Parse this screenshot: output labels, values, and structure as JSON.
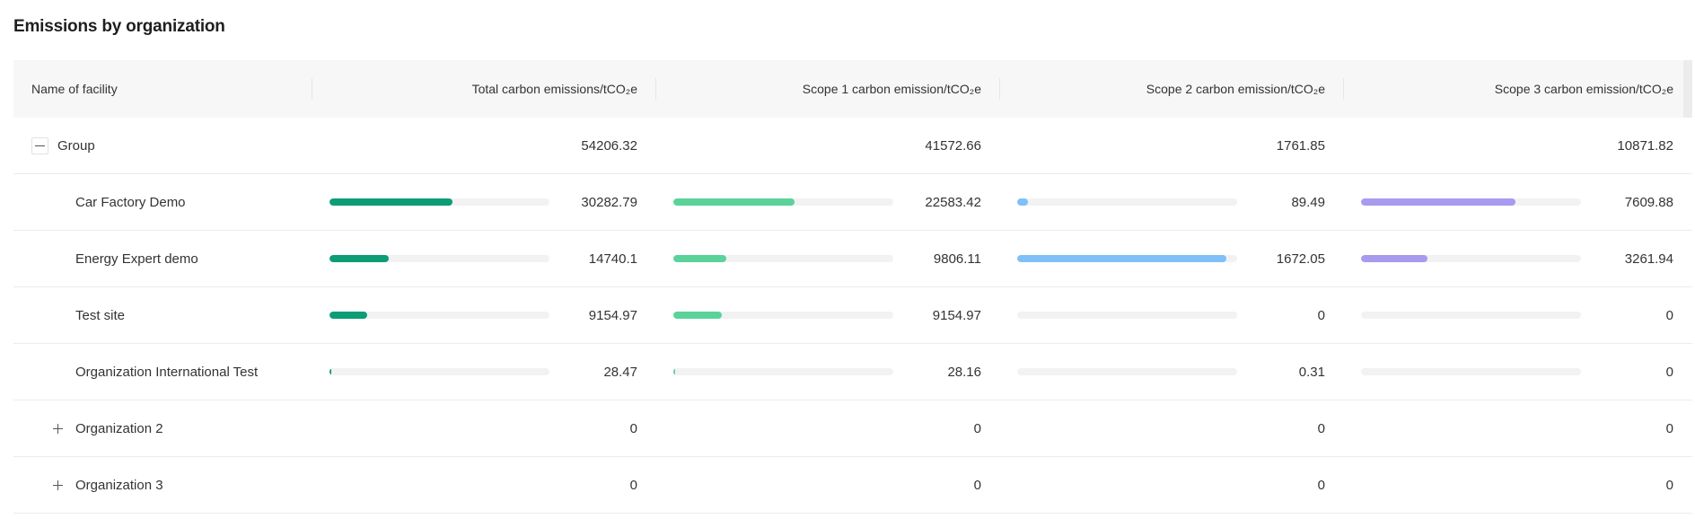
{
  "title": "Emissions by organization",
  "columns": {
    "name": "Name of facility",
    "total": "Total carbon emissions/tCO₂e",
    "scope1": "Scope 1 carbon emission/tCO₂e",
    "scope2": "Scope 2 carbon emission/tCO₂e",
    "scope3": "Scope 3 carbon emission/tCO₂e"
  },
  "colors": {
    "total": "#0c9d77",
    "scope1": "#5bd29a",
    "scope2": "#7ec0f7",
    "scope3": "#a79bf0"
  },
  "rows": [
    {
      "name": "Group",
      "level": 0,
      "expander": "collapse",
      "showBars": false,
      "total": "54206.32",
      "scope1": "41572.66",
      "scope2": "1761.85",
      "scope3": "10871.82"
    },
    {
      "name": "Car Factory Demo",
      "level": 1,
      "expander": "none",
      "showBars": true,
      "total": "30282.79",
      "scope1": "22583.42",
      "scope2": "89.49",
      "scope3": "7609.88",
      "progress": {
        "total": 0.56,
        "scope1": 0.55,
        "scope2": 0.05,
        "scope3": 0.7
      }
    },
    {
      "name": "Energy Expert demo",
      "level": 1,
      "expander": "none",
      "showBars": true,
      "total": "14740.1",
      "scope1": "9806.11",
      "scope2": "1672.05",
      "scope3": "3261.94",
      "progress": {
        "total": 0.27,
        "scope1": 0.24,
        "scope2": 0.95,
        "scope3": 0.3
      }
    },
    {
      "name": "Test site",
      "level": 1,
      "expander": "none",
      "showBars": true,
      "total": "9154.97",
      "scope1": "9154.97",
      "scope2": "0",
      "scope3": "0",
      "progress": {
        "total": 0.17,
        "scope1": 0.22,
        "scope2": 0,
        "scope3": 0
      }
    },
    {
      "name": "Organization International Test",
      "level": 1,
      "expander": "none",
      "showBars": true,
      "total": "28.47",
      "scope1": "28.16",
      "scope2": "0.31",
      "scope3": "0",
      "progress": {
        "total": 0.005,
        "scope1": 0.005,
        "scope2": 0,
        "scope3": 0
      }
    },
    {
      "name": "Organization 2",
      "level": 1,
      "expander": "expand",
      "showBars": false,
      "total": "0",
      "scope1": "0",
      "scope2": "0",
      "scope3": "0"
    },
    {
      "name": "Organization 3",
      "level": 1,
      "expander": "expand",
      "showBars": false,
      "total": "0",
      "scope1": "0",
      "scope2": "0",
      "scope3": "0"
    }
  ]
}
